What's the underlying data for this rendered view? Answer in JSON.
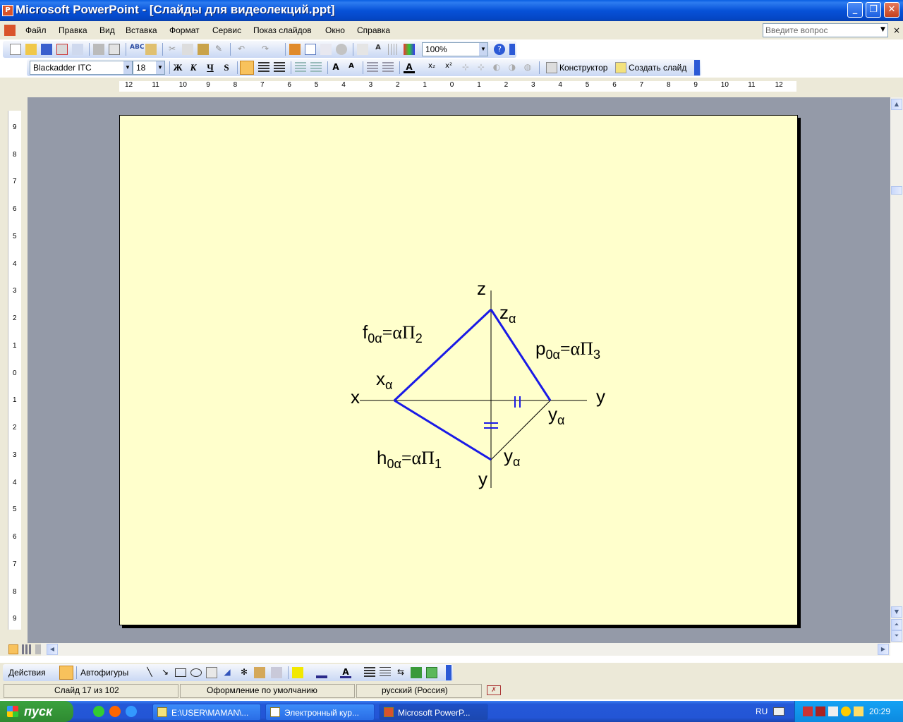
{
  "window": {
    "title": "Microsoft PowerPoint - [Слайды для видеолекций.ppt]"
  },
  "menu": [
    "Файл",
    "Правка",
    "Вид",
    "Вставка",
    "Формат",
    "Сервис",
    "Показ слайдов",
    "Окно",
    "Справка"
  ],
  "help_box": {
    "placeholder": "Введите вопрос"
  },
  "standard_toolbar": {
    "zoom": "100%"
  },
  "formatting_toolbar": {
    "font": "Blackadder ITC",
    "size": "18",
    "bold": "Ж",
    "italic": "К",
    "underline": "Ч",
    "shadow": "S",
    "designer": "Конструктор",
    "new_slide": "Создать слайд"
  },
  "ruler": {
    "horizontal": [
      "12",
      "11",
      "10",
      "9",
      "8",
      "7",
      "6",
      "5",
      "4",
      "3",
      "2",
      "1",
      "0",
      "1",
      "2",
      "3",
      "4",
      "5",
      "6",
      "7",
      "8",
      "9",
      "10",
      "11",
      "12"
    ],
    "vertical": [
      "9",
      "8",
      "7",
      "6",
      "5",
      "4",
      "3",
      "2",
      "1",
      "0",
      "1",
      "2",
      "3",
      "4",
      "5",
      "6",
      "7",
      "8",
      "9"
    ]
  },
  "slide": {
    "labels": {
      "z_axis": "z",
      "x_axis": "x",
      "y_axis_right": "y",
      "y_axis_bottom": "y",
      "f_trace": {
        "base": "f",
        "sub": "0α",
        "eq": "=αΠ",
        "idx": "2"
      },
      "p_trace": {
        "base": "p",
        "sub": "0α",
        "eq": "=αΠ",
        "idx": "3"
      },
      "h_trace": {
        "base": "h",
        "sub": "0α",
        "eq": "=αΠ",
        "idx": "1"
      },
      "x_alpha": {
        "base": "x",
        "sub": "α"
      },
      "z_alpha": {
        "base": "z",
        "sub": "α"
      },
      "y_alpha_right": {
        "base": "y",
        "sub": "α"
      },
      "y_alpha_bottom": {
        "base": "y",
        "sub": "α"
      }
    },
    "colors": {
      "trace_lines": "#1a1ae6",
      "axes": "#000000",
      "background": "#ffffcc"
    }
  },
  "drawing_toolbar": {
    "actions": "Действия",
    "autoshapes": "Автофигуры"
  },
  "status": {
    "slide": "Слайд 17 из 102",
    "design": "Оформление по умолчанию",
    "language": "русский (Россия)"
  },
  "taskbar": {
    "start": "пуск",
    "tasks": [
      "E:\\USER\\MAMAN\\...",
      "Электронный кур...",
      "Microsoft PowerP..."
    ],
    "lang": "RU",
    "clock": "20:29"
  }
}
